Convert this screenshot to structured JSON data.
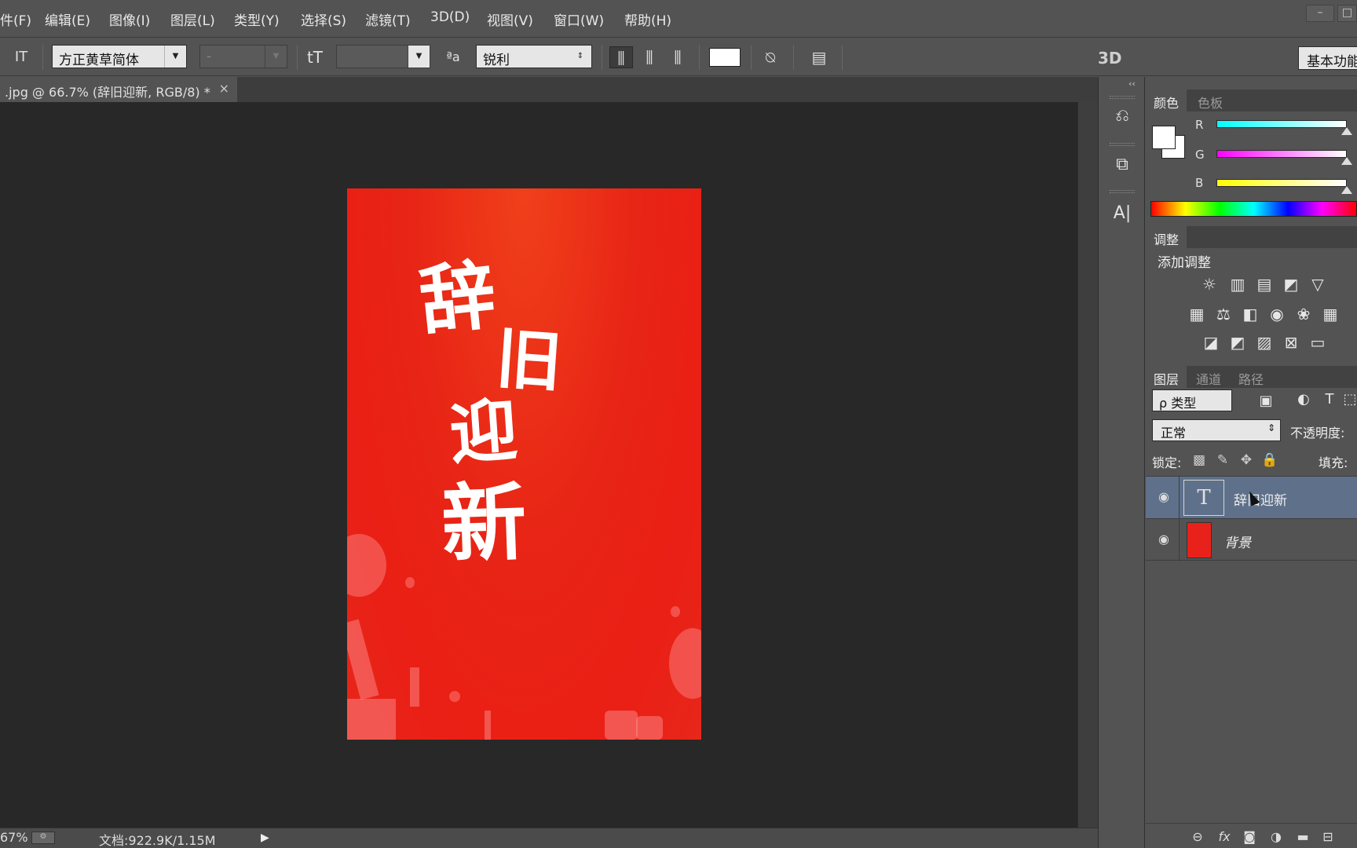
{
  "menu": [
    "件(F)",
    "编辑(E)",
    "图像(I)",
    "图层(L)",
    "类型(Y)",
    "选择(S)",
    "滤镜(T)",
    "3D(D)",
    "视图(V)",
    "窗口(W)",
    "帮助(H)"
  ],
  "window_controls": {
    "minimize": "–",
    "restore": "□"
  },
  "options": {
    "tool_icon": "IT",
    "font_family": "方正黄草简体",
    "font_style": "-",
    "size_icon": "tT",
    "aa_icon": "ªa",
    "antialias": "锐利",
    "three_d": "3D",
    "workspace": "基本功能"
  },
  "document": {
    "tab_title": ".jpg @ 66.7% (辞旧迎新, RGB/8) *",
    "close": "×"
  },
  "poster": {
    "line1": "辞",
    "line2": "旧",
    "line3": "迎",
    "line4": "新"
  },
  "status": {
    "zoom": "67%",
    "doc": "文档:922.9K/1.15M",
    "play": "▶"
  },
  "dock": {
    "collapse": "‹‹",
    "icons": [
      "history-icon",
      "3d-material-icon",
      "character-icon"
    ],
    "glyphs": [
      "⎌",
      "⧉",
      "A|"
    ]
  },
  "color_panel": {
    "tabs": [
      "颜色",
      "色板"
    ],
    "channels": [
      {
        "label": "R",
        "color": "#00ffff"
      },
      {
        "label": "G",
        "color": "#ff00ff"
      },
      {
        "label": "B",
        "color": "#ffff00"
      }
    ],
    "foreground": "#ffffff",
    "background": "#ffffff"
  },
  "adjust_panel": {
    "tab": "调整",
    "title": "添加调整",
    "row1": [
      "☼",
      "▥",
      "▤",
      "◩",
      "▽"
    ],
    "row2": [
      "▦",
      "⚖",
      "◧",
      "◉",
      "❀",
      "▦"
    ],
    "row3": [
      "◪",
      "◩",
      "▨",
      "⊠",
      "▭"
    ]
  },
  "layers_panel": {
    "tabs": [
      "图层",
      "通道",
      "路径"
    ],
    "filter": "ρ 类型",
    "filter_icons": [
      "▣",
      "◐",
      "T",
      "⬚"
    ],
    "blend_mode": "正常",
    "opacity_label": "不透明度:",
    "lock_label": "锁定:",
    "lock_icons": [
      "▩",
      "✎",
      "✥",
      "🔒"
    ],
    "fill_label": "填充:",
    "layers": [
      {
        "name": "辞旧迎新",
        "type": "text",
        "thumb": "T",
        "selected": true
      },
      {
        "name": "背景",
        "type": "background",
        "selected": false
      }
    ],
    "bottom_icons": [
      "⊖",
      "fx",
      "◙",
      "◑",
      "▬",
      "⊟"
    ]
  }
}
